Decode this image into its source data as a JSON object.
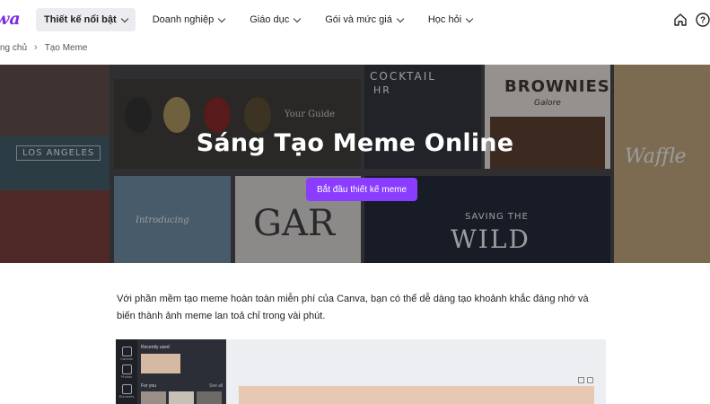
{
  "header": {
    "logo_text": "wa",
    "brand_color": "#7d2ae8",
    "nav": [
      {
        "label": "Thiết kế nổi bật",
        "active": true
      },
      {
        "label": "Doanh nghiệp",
        "active": false
      },
      {
        "label": "Giáo dục",
        "active": false
      },
      {
        "label": "Gói và mức giá",
        "active": false
      },
      {
        "label": "Học hỏi",
        "active": false
      }
    ],
    "icons": [
      "home-icon",
      "help-icon"
    ]
  },
  "breadcrumb": {
    "home": "ng chủ",
    "current": "Tạo Meme"
  },
  "hero": {
    "title": "Sáng Tạo Meme Online",
    "cta_label": "Bắt đầu thiết kế meme",
    "cta_color": "#8b3dff",
    "tiles": {
      "los_angeles": "LOS ANGELES",
      "food_guide": "Your Guide",
      "cocktail": "COCKTAIL",
      "cocktail_sub": "HR",
      "brownies": "BROWNIES",
      "brownies_sub": "Galore",
      "introducing": "Introducing",
      "garden": "GAR",
      "saving": "SAVING THE",
      "wild": "WILD",
      "waffles": "Waffle"
    }
  },
  "intro": {
    "text": "Với phần mềm tạo meme hoàn toàn miễn phí của Canva, bạn có thể dễ dàng tạo khoảnh khắc đáng nhớ và biến thành ảnh meme lan toả chỉ trong vài phút."
  },
  "preview": {
    "recently_used": "Recently used",
    "for_you": "For you",
    "see_all": "See all",
    "side_labels": [
      "Canvas",
      "Photos",
      "Elements"
    ]
  }
}
